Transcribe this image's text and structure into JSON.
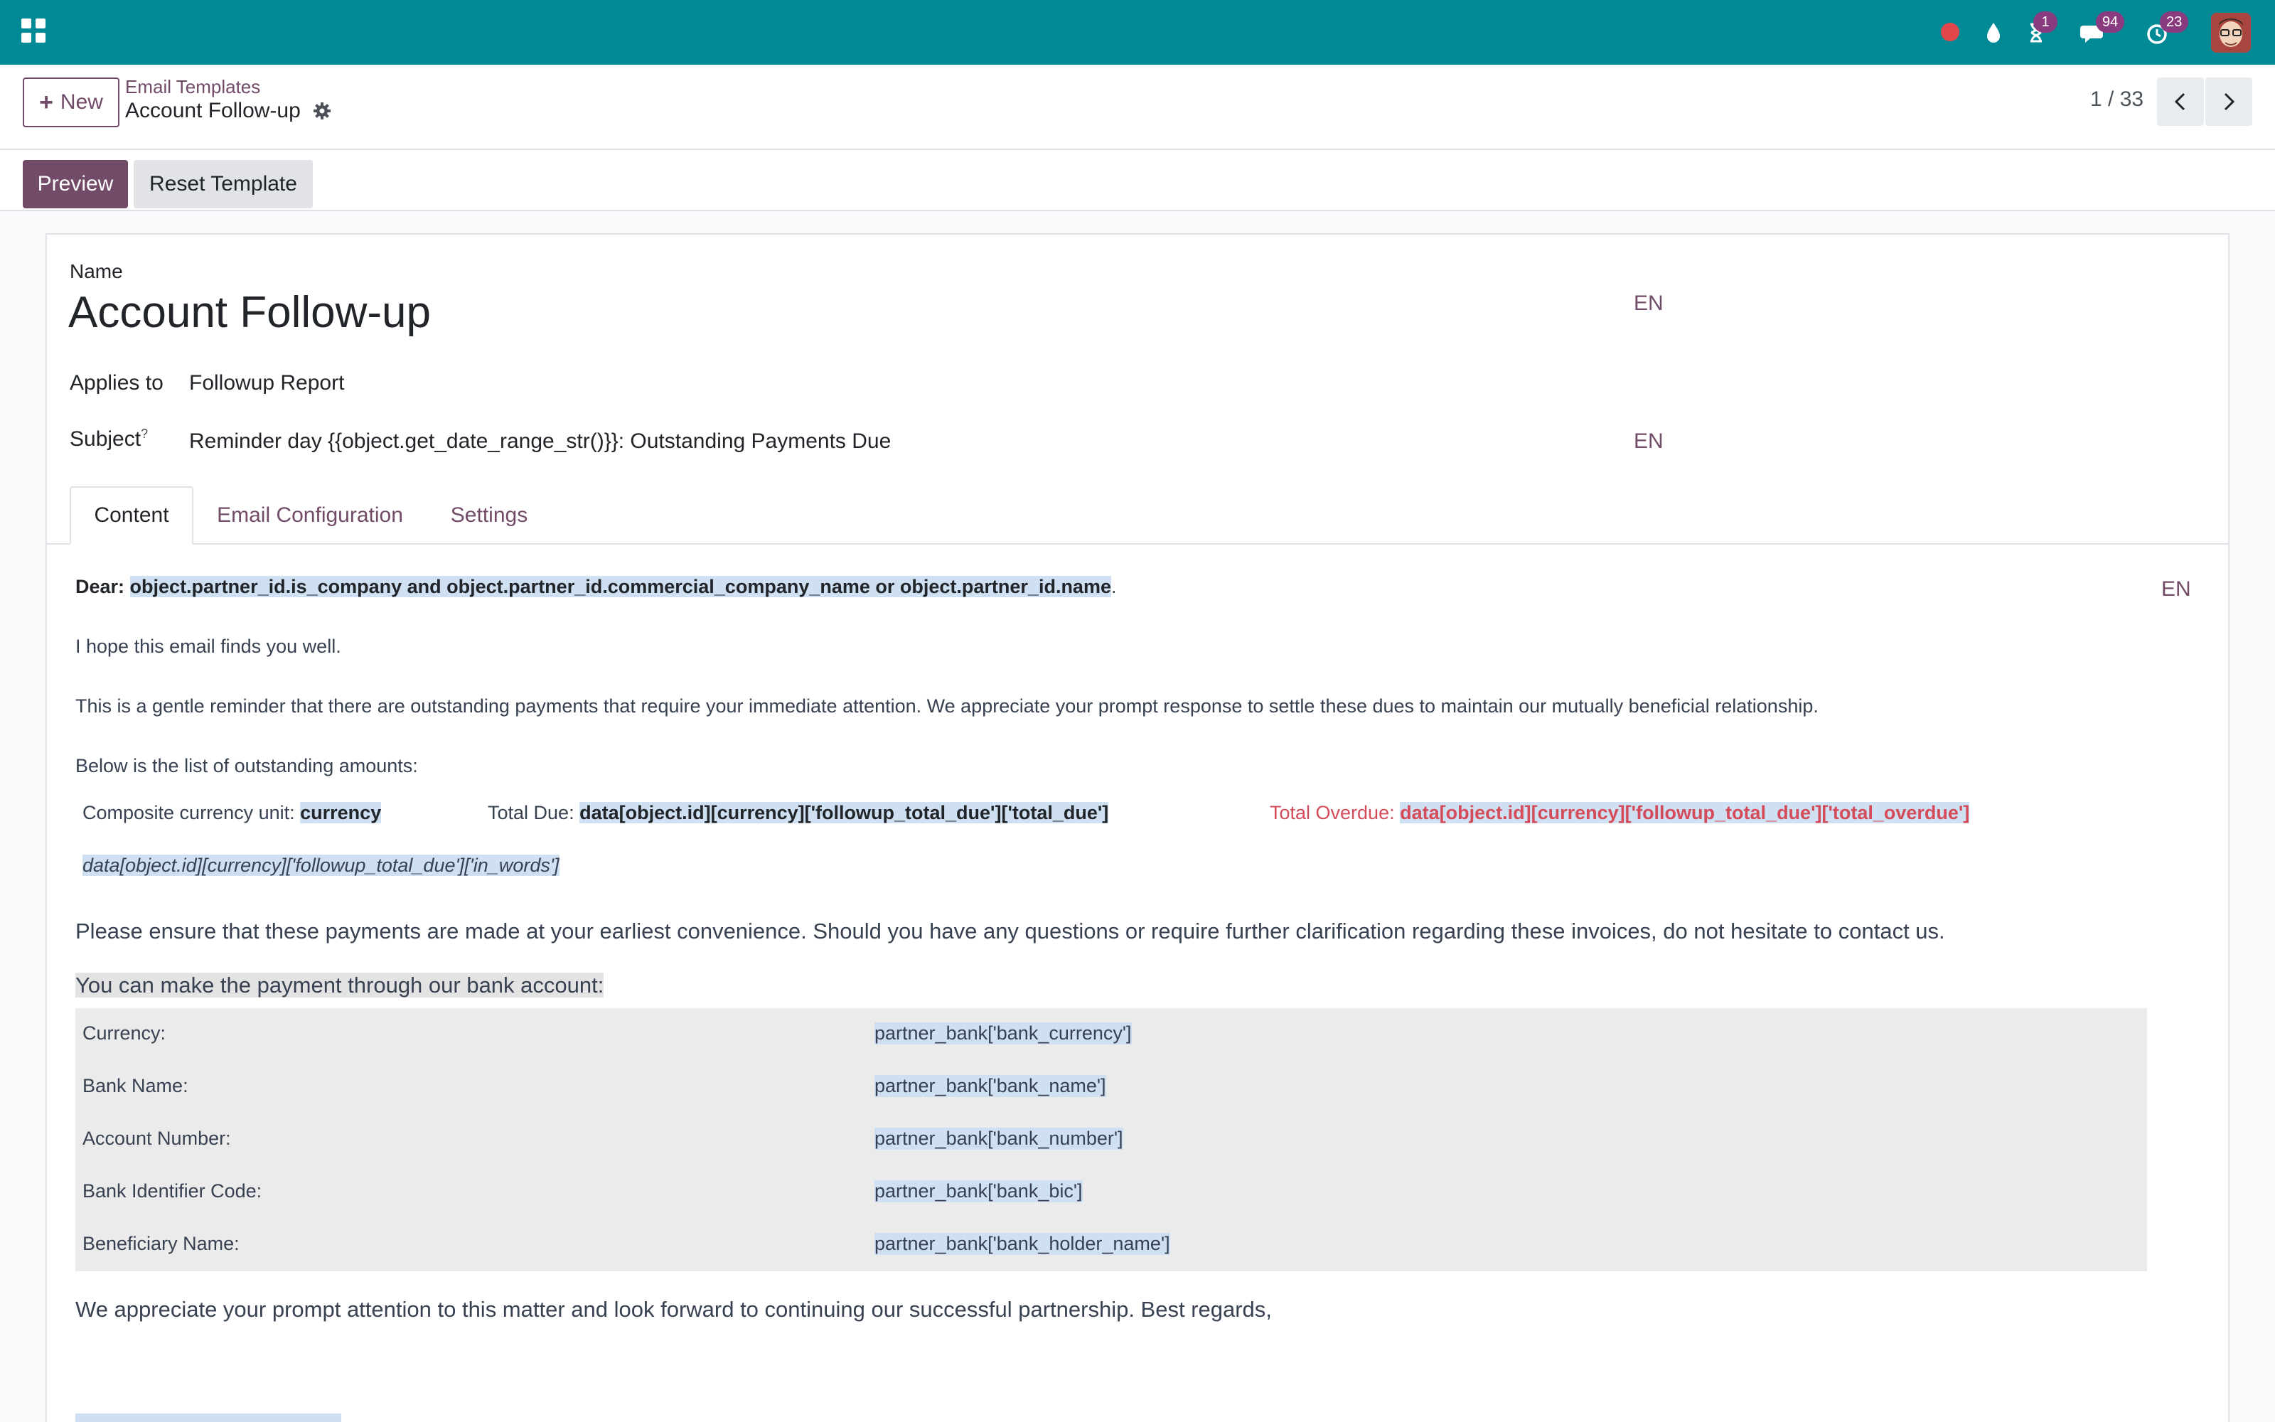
{
  "navbar": {
    "app_icon": "apps-grid-icon",
    "activity_badge": "1",
    "messages_badge": "94",
    "updates_badge": "23"
  },
  "control": {
    "new_label": "New",
    "breadcrumb_parent": "Email Templates",
    "breadcrumb_current": "Account Follow-up",
    "pager": "1 / 33"
  },
  "status_buttons": {
    "preview": "Preview",
    "reset": "Reset Template"
  },
  "form": {
    "name_label": "Name",
    "name_value": "Account Follow-up",
    "lang": "EN",
    "applies_label": "Applies to",
    "applies_value": "Followup Report",
    "subject_label": "Subject",
    "subject_help": "?",
    "subject_value": "Reminder day {{object.get_date_range_str()}}: Outstanding Payments Due"
  },
  "tabs": [
    {
      "label": "Content"
    },
    {
      "label": "Email Configuration"
    },
    {
      "label": "Settings"
    }
  ],
  "body": {
    "dear_label": "Dear:",
    "dear_expr": "object.partner_id.is_company and object.partner_id.commercial_company_name or object.partner_id.name",
    "dear_suffix": ".",
    "line1": "I hope this email finds you well.",
    "line2": "This is a gentle reminder that there are outstanding payments that require your immediate attention. We appreciate your prompt response to settle these dues to maintain our mutually beneficial relationship.",
    "line3": "Below is the list of outstanding amounts:",
    "currency_label": "Composite currency unit:",
    "currency_expr": "currency",
    "total_due_label": "Total Due:",
    "total_due_expr": "data[object.id][currency]['followup_total_due']['total_due']",
    "total_overdue_label": "Total Overdue:",
    "total_overdue_expr": "data[object.id][currency]['followup_total_due']['total_overdue']",
    "in_words_expr": "data[object.id][currency]['followup_total_due']['in_words']",
    "line4": "Please ensure that these payments are made at your earliest convenience. Should you have any questions or require further clarification regarding these invoices, do not hesitate to contact us.",
    "bank_intro": "You can make the payment through our bank account:",
    "bank_rows": [
      {
        "label": "Currency:",
        "value": "partner_bank['bank_currency']"
      },
      {
        "label": "Bank Name:",
        "value": "partner_bank['bank_name']"
      },
      {
        "label": "Account Number:",
        "value": "partner_bank['bank_number']"
      },
      {
        "label": "Bank Identifier Code:",
        "value": "partner_bank['bank_bic']"
      },
      {
        "label": "Beneficiary Name:",
        "value": "partner_bank['bank_holder_name']"
      }
    ],
    "closing": "We appreciate your prompt attention to this matter and look forward to continuing our successful partnership. Best regards,"
  }
}
